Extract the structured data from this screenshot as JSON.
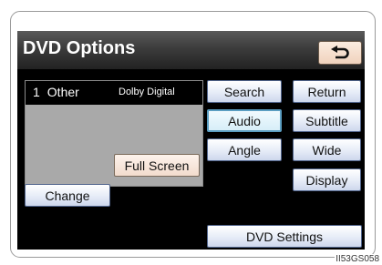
{
  "screen": {
    "title": "DVD Options",
    "back_icon": "return-arrow-icon"
  },
  "info_bar": {
    "track_number": "1",
    "track_type": "Other",
    "audio_format": "Dolby Digital"
  },
  "buttons": {
    "search": "Search",
    "return": "Return",
    "audio": "Audio",
    "subtitle": "Subtitle",
    "angle": "Angle",
    "wide": "Wide",
    "display": "Display",
    "full_screen": "Full Screen",
    "change": "Change",
    "dvd_settings": "DVD Settings"
  },
  "selected_button": "Audio",
  "image_code": "II53GS058",
  "colors": {
    "button_border": "#50648c",
    "selected_border": "#5b9ec2",
    "screen_background": "#000000",
    "video_area": "#a9a9a9"
  }
}
